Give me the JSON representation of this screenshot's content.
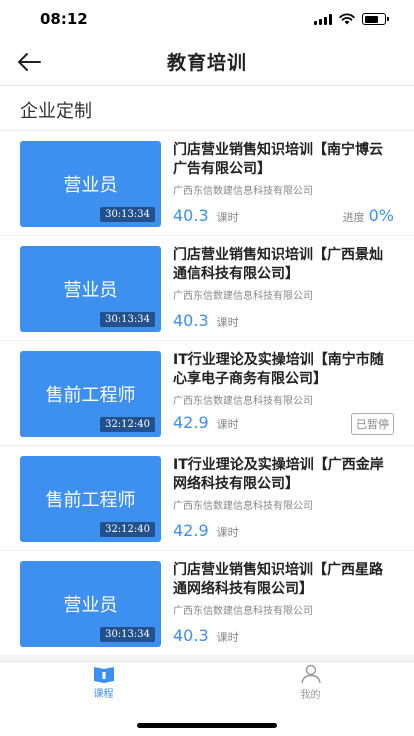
{
  "status": {
    "time": "08:12"
  },
  "nav": {
    "title": "教育培训"
  },
  "section": {
    "title": "企业定制"
  },
  "courses": [
    {
      "thumb": "营业员",
      "duration": "30:13:34",
      "title": "门店营业销售知识培训【南宁博云广告有限公司】",
      "company": "广西东信数建信息科技有限公司",
      "hours": "40.3",
      "unit": "课时",
      "progress_label": "进度",
      "progress": "0%",
      "badge": ""
    },
    {
      "thumb": "营业员",
      "duration": "30:13:34",
      "title": "门店营业销售知识培训【广西景灿通信科技有限公司】",
      "company": "广西东信数建信息科技有限公司",
      "hours": "40.3",
      "unit": "课时",
      "progress_label": "",
      "progress": "",
      "badge": ""
    },
    {
      "thumb": "售前工程师",
      "duration": "32:12:40",
      "title": "IT行业理论及实操培训【南宁市随心享电子商务有限公司】",
      "company": "广西东信数建信息科技有限公司",
      "hours": "42.9",
      "unit": "课时",
      "progress_label": "",
      "progress": "",
      "badge": "已暂停"
    },
    {
      "thumb": "售前工程师",
      "duration": "32:12:40",
      "title": "IT行业理论及实操培训【广西金岸网络科技有限公司】",
      "company": "广西东信数建信息科技有限公司",
      "hours": "42.9",
      "unit": "课时",
      "progress_label": "",
      "progress": "",
      "badge": ""
    },
    {
      "thumb": "营业员",
      "duration": "30:13:34",
      "title": "门店营业销售知识培训【广西星路通网络科技有限公司】",
      "company": "广西东信数建信息科技有限公司",
      "hours": "40.3",
      "unit": "课时",
      "progress_label": "",
      "progress": "",
      "badge": ""
    }
  ],
  "tabs": [
    {
      "label": "课程",
      "icon": "book-icon"
    },
    {
      "label": "我的",
      "icon": "person-icon"
    }
  ],
  "colors": {
    "accent": "#3d8ff0"
  }
}
